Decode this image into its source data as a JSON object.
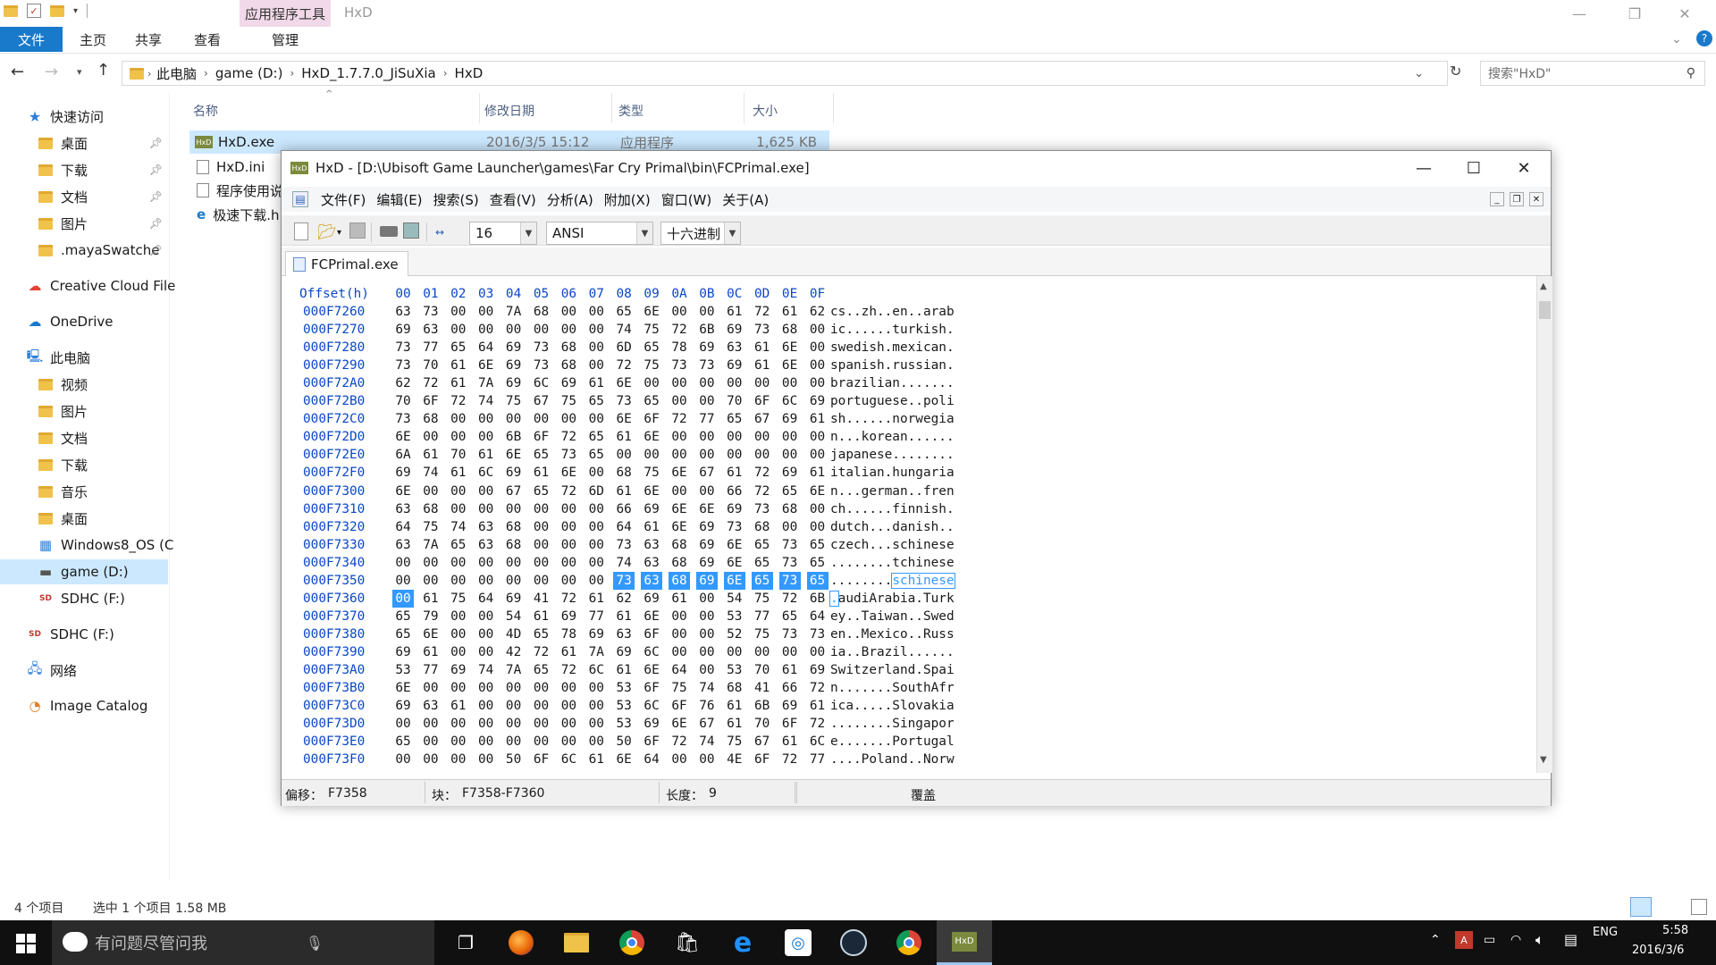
{
  "explorer": {
    "title": "HxD",
    "ribbon_context_label": "应用程序工具",
    "tabs": {
      "file": "文件",
      "home": "主页",
      "share": "共享",
      "view": "查看",
      "manage": "管理"
    },
    "breadcrumb": [
      "此电脑",
      "game (D:)",
      "HxD_1.7.7.0_JiSuXia",
      "HxD"
    ],
    "search_placeholder": "搜索\"HxD\"",
    "nav": {
      "quick_access": "快速访问",
      "qa_items": [
        "桌面",
        "下载",
        "文档",
        "图片",
        ".mayaSwatche"
      ],
      "creative_cloud": "Creative Cloud File",
      "onedrive": "OneDrive",
      "this_pc": "此电脑",
      "pc_items": [
        "视频",
        "图片",
        "文档",
        "下载",
        "音乐",
        "桌面"
      ],
      "drive_c": "Windows8_OS (C",
      "drive_d": "game (D:)",
      "drive_f1": "SDHC (F:)",
      "drive_f2": "SDHC (F:)",
      "network": "网络",
      "image_catalog": "Image Catalog"
    },
    "columns": {
      "name": "名称",
      "modified": "修改日期",
      "type": "类型",
      "size": "大小"
    },
    "files": [
      {
        "name": "HxD.exe",
        "modified": "2016/3/5 15:12",
        "type": "应用程序",
        "size": "1,625 KB"
      },
      {
        "name": "HxD.ini"
      },
      {
        "name": "程序使用说"
      },
      {
        "name": "极速下载.h"
      }
    ],
    "status_count": "4 个项目",
    "status_selected": "选中 1 个项目  1.58 MB"
  },
  "hxd": {
    "title": "HxD - [D:\\Ubisoft Game Launcher\\games\\Far Cry Primal\\bin\\FCPrimal.exe]",
    "menu": [
      "文件(F)",
      "编辑(E)",
      "搜索(S)",
      "查看(V)",
      "分析(A)",
      "附加(X)",
      "窗口(W)",
      "关于(A)"
    ],
    "bytes_per_row": "16",
    "charset": "ANSI",
    "display_mode": "十六进制",
    "tab_label": "FCPrimal.exe",
    "offset_header": "Offset(h)",
    "col_headers": [
      "00",
      "01",
      "02",
      "03",
      "04",
      "05",
      "06",
      "07",
      "08",
      "09",
      "0A",
      "0B",
      "0C",
      "0D",
      "0E",
      "0F"
    ],
    "rows": [
      {
        "off": "000F7260",
        "hex": [
          "63",
          "73",
          "00",
          "00",
          "7A",
          "68",
          "00",
          "00",
          "65",
          "6E",
          "00",
          "00",
          "61",
          "72",
          "61",
          "62"
        ],
        "ascii": "cs..zh..en..arab"
      },
      {
        "off": "000F7270",
        "hex": [
          "69",
          "63",
          "00",
          "00",
          "00",
          "00",
          "00",
          "00",
          "74",
          "75",
          "72",
          "6B",
          "69",
          "73",
          "68",
          "00"
        ],
        "ascii": "ic......turkish."
      },
      {
        "off": "000F7280",
        "hex": [
          "73",
          "77",
          "65",
          "64",
          "69",
          "73",
          "68",
          "00",
          "6D",
          "65",
          "78",
          "69",
          "63",
          "61",
          "6E",
          "00"
        ],
        "ascii": "swedish.mexican."
      },
      {
        "off": "000F7290",
        "hex": [
          "73",
          "70",
          "61",
          "6E",
          "69",
          "73",
          "68",
          "00",
          "72",
          "75",
          "73",
          "73",
          "69",
          "61",
          "6E",
          "00"
        ],
        "ascii": "spanish.russian."
      },
      {
        "off": "000F72A0",
        "hex": [
          "62",
          "72",
          "61",
          "7A",
          "69",
          "6C",
          "69",
          "61",
          "6E",
          "00",
          "00",
          "00",
          "00",
          "00",
          "00",
          "00"
        ],
        "ascii": "brazilian......."
      },
      {
        "off": "000F72B0",
        "hex": [
          "70",
          "6F",
          "72",
          "74",
          "75",
          "67",
          "75",
          "65",
          "73",
          "65",
          "00",
          "00",
          "70",
          "6F",
          "6C",
          "69"
        ],
        "ascii": "portuguese..poli"
      },
      {
        "off": "000F72C0",
        "hex": [
          "73",
          "68",
          "00",
          "00",
          "00",
          "00",
          "00",
          "00",
          "6E",
          "6F",
          "72",
          "77",
          "65",
          "67",
          "69",
          "61"
        ],
        "ascii": "sh......norwegia"
      },
      {
        "off": "000F72D0",
        "hex": [
          "6E",
          "00",
          "00",
          "00",
          "6B",
          "6F",
          "72",
          "65",
          "61",
          "6E",
          "00",
          "00",
          "00",
          "00",
          "00",
          "00"
        ],
        "ascii": "n...korean......"
      },
      {
        "off": "000F72E0",
        "hex": [
          "6A",
          "61",
          "70",
          "61",
          "6E",
          "65",
          "73",
          "65",
          "00",
          "00",
          "00",
          "00",
          "00",
          "00",
          "00",
          "00"
        ],
        "ascii": "japanese........"
      },
      {
        "off": "000F72F0",
        "hex": [
          "69",
          "74",
          "61",
          "6C",
          "69",
          "61",
          "6E",
          "00",
          "68",
          "75",
          "6E",
          "67",
          "61",
          "72",
          "69",
          "61"
        ],
        "ascii": "italian.hungaria"
      },
      {
        "off": "000F7300",
        "hex": [
          "6E",
          "00",
          "00",
          "00",
          "67",
          "65",
          "72",
          "6D",
          "61",
          "6E",
          "00",
          "00",
          "66",
          "72",
          "65",
          "6E"
        ],
        "ascii": "n...german..fren"
      },
      {
        "off": "000F7310",
        "hex": [
          "63",
          "68",
          "00",
          "00",
          "00",
          "00",
          "00",
          "00",
          "66",
          "69",
          "6E",
          "6E",
          "69",
          "73",
          "68",
          "00"
        ],
        "ascii": "ch......finnish."
      },
      {
        "off": "000F7320",
        "hex": [
          "64",
          "75",
          "74",
          "63",
          "68",
          "00",
          "00",
          "00",
          "64",
          "61",
          "6E",
          "69",
          "73",
          "68",
          "00",
          "00"
        ],
        "ascii": "dutch...danish.."
      },
      {
        "off": "000F7330",
        "hex": [
          "63",
          "7A",
          "65",
          "63",
          "68",
          "00",
          "00",
          "00",
          "73",
          "63",
          "68",
          "69",
          "6E",
          "65",
          "73",
          "65"
        ],
        "ascii": "czech...schinese"
      },
      {
        "off": "000F7340",
        "hex": [
          "00",
          "00",
          "00",
          "00",
          "00",
          "00",
          "00",
          "00",
          "74",
          "63",
          "68",
          "69",
          "6E",
          "65",
          "73",
          "65"
        ],
        "ascii": "........tchinese"
      },
      {
        "off": "000F7350",
        "hex": [
          "00",
          "00",
          "00",
          "00",
          "00",
          "00",
          "00",
          "00",
          "73",
          "63",
          "68",
          "69",
          "6E",
          "65",
          "73",
          "65"
        ],
        "ascii": "........schinese"
      },
      {
        "off": "000F7360",
        "hex": [
          "00",
          "61",
          "75",
          "64",
          "69",
          "41",
          "72",
          "61",
          "62",
          "69",
          "61",
          "00",
          "54",
          "75",
          "72",
          "6B"
        ],
        "ascii": ".audiArabia.Turk"
      },
      {
        "off": "000F7370",
        "hex": [
          "65",
          "79",
          "00",
          "00",
          "54",
          "61",
          "69",
          "77",
          "61",
          "6E",
          "00",
          "00",
          "53",
          "77",
          "65",
          "64"
        ],
        "ascii": "ey..Taiwan..Swed"
      },
      {
        "off": "000F7380",
        "hex": [
          "65",
          "6E",
          "00",
          "00",
          "4D",
          "65",
          "78",
          "69",
          "63",
          "6F",
          "00",
          "00",
          "52",
          "75",
          "73",
          "73"
        ],
        "ascii": "en..Mexico..Russ"
      },
      {
        "off": "000F7390",
        "hex": [
          "69",
          "61",
          "00",
          "00",
          "42",
          "72",
          "61",
          "7A",
          "69",
          "6C",
          "00",
          "00",
          "00",
          "00",
          "00",
          "00"
        ],
        "ascii": "ia..Brazil......"
      },
      {
        "off": "000F73A0",
        "hex": [
          "53",
          "77",
          "69",
          "74",
          "7A",
          "65",
          "72",
          "6C",
          "61",
          "6E",
          "64",
          "00",
          "53",
          "70",
          "61",
          "69"
        ],
        "ascii": "Switzerland.Spai"
      },
      {
        "off": "000F73B0",
        "hex": [
          "6E",
          "00",
          "00",
          "00",
          "00",
          "00",
          "00",
          "00",
          "53",
          "6F",
          "75",
          "74",
          "68",
          "41",
          "66",
          "72"
        ],
        "ascii": "n.......SouthAfr"
      },
      {
        "off": "000F73C0",
        "hex": [
          "69",
          "63",
          "61",
          "00",
          "00",
          "00",
          "00",
          "00",
          "53",
          "6C",
          "6F",
          "76",
          "61",
          "6B",
          "69",
          "61"
        ],
        "ascii": "ica.....Slovakia"
      },
      {
        "off": "000F73D0",
        "hex": [
          "00",
          "00",
          "00",
          "00",
          "00",
          "00",
          "00",
          "00",
          "53",
          "69",
          "6E",
          "67",
          "61",
          "70",
          "6F",
          "72"
        ],
        "ascii": "........Singapor"
      },
      {
        "off": "000F73E0",
        "hex": [
          "65",
          "00",
          "00",
          "00",
          "00",
          "00",
          "00",
          "00",
          "50",
          "6F",
          "72",
          "74",
          "75",
          "67",
          "61",
          "6C"
        ],
        "ascii": "e.......Portugal"
      },
      {
        "off": "000F73F0",
        "hex": [
          "00",
          "00",
          "00",
          "00",
          "50",
          "6F",
          "6C",
          "61",
          "6E",
          "64",
          "00",
          "00",
          "4E",
          "6F",
          "72",
          "77"
        ],
        "ascii": "....Poland..Norw"
      }
    ],
    "status": {
      "offset_label": "偏移：",
      "offset_value": "F7358",
      "block_label": "块：",
      "block_value": "F7358-F7360",
      "length_label": "长度：",
      "length_value": "9",
      "mode": "覆盖"
    }
  },
  "taskbar": {
    "search_placeholder": "有问题尽管问我",
    "lang": "ENG",
    "time": "5:58",
    "date": "2016/3/6"
  },
  "colors": {
    "selection": "#3399ff",
    "offset_blue": "#0a47c8",
    "ribbon_file": "#1979ca"
  }
}
